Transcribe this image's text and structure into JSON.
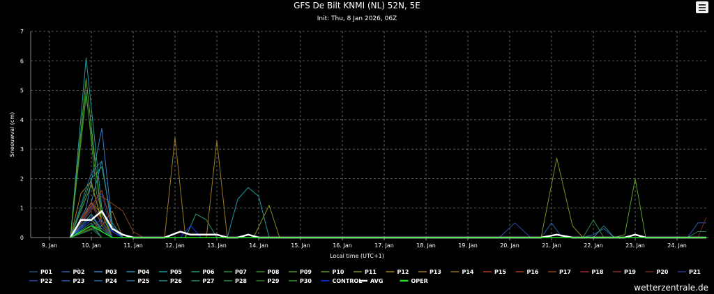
{
  "chart_data": {
    "type": "line",
    "title": "GFS De Bilt KNMI (NL) 52N, 5E",
    "subtitle": "Init: Thu, 8 Jan 2026, 06Z",
    "xlabel": "Local time (UTC+1)",
    "ylabel": "Sneeuwval (cm)",
    "ylim": [
      0,
      7
    ],
    "yticks": [
      0,
      1,
      2,
      3,
      4,
      5,
      6,
      7
    ],
    "xlim": [
      8.55,
      24.75
    ],
    "xticks": [
      {
        "x": 9,
        "label": "9. Jan"
      },
      {
        "x": 10,
        "label": "10. Jan"
      },
      {
        "x": 11,
        "label": "11. Jan"
      },
      {
        "x": 12,
        "label": "12. Jan"
      },
      {
        "x": 13,
        "label": "13. Jan"
      },
      {
        "x": 14,
        "label": "14. Jan"
      },
      {
        "x": 15,
        "label": "15. Jan"
      },
      {
        "x": 16,
        "label": "16. Jan"
      },
      {
        "x": 17,
        "label": "17. Jan"
      },
      {
        "x": 18,
        "label": "18. Jan"
      },
      {
        "x": 19,
        "label": "19. Jan"
      },
      {
        "x": 20,
        "label": "20. Jan"
      },
      {
        "x": 21,
        "label": "21. Jan"
      },
      {
        "x": 22,
        "label": "22. Jan"
      },
      {
        "x": 23,
        "label": "23. Jan"
      },
      {
        "x": 24,
        "label": "24. Jan"
      }
    ],
    "grid": true,
    "legend_position": "bottom",
    "series": [
      {
        "name": "P01",
        "color": "#1f4e8c",
        "points": [
          [
            9.5,
            0
          ],
          [
            9.75,
            0.3
          ],
          [
            10,
            0.8
          ],
          [
            10.25,
            0.3
          ],
          [
            10.5,
            0
          ],
          [
            24.7,
            0
          ]
        ]
      },
      {
        "name": "P02",
        "color": "#2266aa",
        "points": [
          [
            9.5,
            0
          ],
          [
            9.75,
            0.5
          ],
          [
            10,
            1.2
          ],
          [
            10.25,
            0.4
          ],
          [
            10.5,
            0
          ],
          [
            24.7,
            0
          ]
        ]
      },
      {
        "name": "P03",
        "color": "#3a7fc8",
        "points": [
          [
            9.5,
            0
          ],
          [
            9.875,
            1.0
          ],
          [
            10.25,
            3.7
          ],
          [
            10.5,
            0.4
          ],
          [
            10.75,
            0
          ],
          [
            24.7,
            0
          ]
        ]
      },
      {
        "name": "P04",
        "color": "#2b8fbf",
        "points": [
          [
            9.5,
            0
          ],
          [
            10,
            1.2
          ],
          [
            10.25,
            2.6
          ],
          [
            10.5,
            0.2
          ],
          [
            10.75,
            0
          ],
          [
            24.7,
            0
          ]
        ]
      },
      {
        "name": "P05",
        "color": "#1f9aa0",
        "points": [
          [
            9.5,
            0
          ],
          [
            9.875,
            6.1
          ],
          [
            10.25,
            1.0
          ],
          [
            10.5,
            0
          ],
          [
            13.25,
            0
          ],
          [
            13.5,
            1.3
          ],
          [
            13.75,
            1.7
          ],
          [
            14,
            1.4
          ],
          [
            14.25,
            0
          ],
          [
            24.7,
            0
          ]
        ]
      },
      {
        "name": "P06",
        "color": "#2a9a6e",
        "points": [
          [
            9.5,
            0
          ],
          [
            10,
            2.0
          ],
          [
            10.25,
            2.4
          ],
          [
            10.5,
            0.5
          ],
          [
            10.75,
            0
          ],
          [
            12.25,
            0
          ],
          [
            12.5,
            0.8
          ],
          [
            12.75,
            0.6
          ],
          [
            13,
            0
          ],
          [
            24.7,
            0
          ]
        ]
      },
      {
        "name": "P07",
        "color": "#2f8f3a",
        "points": [
          [
            9.5,
            0
          ],
          [
            9.875,
            5.0
          ],
          [
            10.125,
            1.5
          ],
          [
            10.5,
            0
          ],
          [
            24.7,
            0
          ]
        ]
      },
      {
        "name": "P08",
        "color": "#3b8f2a",
        "points": [
          [
            9.5,
            0
          ],
          [
            9.875,
            4.8
          ],
          [
            10.25,
            0.8
          ],
          [
            10.5,
            0
          ],
          [
            24.7,
            0
          ]
        ]
      },
      {
        "name": "P09",
        "color": "#4c9a28",
        "points": [
          [
            9.5,
            0
          ],
          [
            10,
            1.8
          ],
          [
            10.25,
            0.6
          ],
          [
            10.5,
            0
          ],
          [
            24.7,
            0
          ]
        ]
      },
      {
        "name": "P10",
        "color": "#5aa02a",
        "points": [
          [
            9.5,
            0
          ],
          [
            9.875,
            5.4
          ],
          [
            10.25,
            0.5
          ],
          [
            10.5,
            0
          ],
          [
            22.5,
            0
          ],
          [
            22.75,
            0.1
          ],
          [
            23,
            2.0
          ],
          [
            23.25,
            0
          ],
          [
            24.7,
            0
          ]
        ]
      },
      {
        "name": "P11",
        "color": "#8a8a20",
        "points": [
          [
            9.5,
            0
          ],
          [
            10,
            1.2
          ],
          [
            10.25,
            0.8
          ],
          [
            10.5,
            0
          ],
          [
            13.875,
            0
          ],
          [
            14.25,
            1.1
          ],
          [
            14.5,
            0
          ],
          [
            20.75,
            0
          ],
          [
            21.125,
            2.7
          ],
          [
            21.5,
            0.4
          ],
          [
            21.75,
            0
          ],
          [
            24.7,
            0
          ]
        ]
      },
      {
        "name": "P12",
        "color": "#9a8a20",
        "points": [
          [
            9.5,
            0
          ],
          [
            10,
            0.4
          ],
          [
            10.25,
            0.3
          ],
          [
            10.5,
            0
          ],
          [
            24.7,
            0
          ]
        ]
      },
      {
        "name": "P13",
        "color": "#a07a20",
        "points": [
          [
            9.5,
            0
          ],
          [
            9.75,
            1.5
          ],
          [
            10,
            1.9
          ],
          [
            10.25,
            0.5
          ],
          [
            10.5,
            0
          ],
          [
            11.75,
            0
          ],
          [
            12,
            3.4
          ],
          [
            12.25,
            0
          ],
          [
            12.75,
            0
          ],
          [
            13,
            3.3
          ],
          [
            13.25,
            0
          ],
          [
            24.7,
            0
          ]
        ]
      },
      {
        "name": "P14",
        "color": "#9a6a1a",
        "points": [
          [
            9.5,
            0
          ],
          [
            10.25,
            0.4
          ],
          [
            10.5,
            0.9
          ],
          [
            10.75,
            0
          ],
          [
            24.7,
            0
          ]
        ]
      },
      {
        "name": "P15",
        "color": "#b04020",
        "points": [
          [
            9.5,
            0
          ],
          [
            10,
            1.2
          ],
          [
            10.25,
            0.6
          ],
          [
            10.5,
            0
          ],
          [
            24.7,
            0
          ]
        ]
      },
      {
        "name": "P16",
        "color": "#a04020",
        "points": [
          [
            9.5,
            0
          ],
          [
            10.25,
            1.6
          ],
          [
            10.5,
            0.3
          ],
          [
            10.75,
            0
          ],
          [
            24.7,
            0
          ]
        ]
      },
      {
        "name": "P17",
        "color": "#904020",
        "points": [
          [
            9.5,
            0
          ],
          [
            10.25,
            1.4
          ],
          [
            10.75,
            0.9
          ],
          [
            11,
            0.2
          ],
          [
            11.25,
            0
          ],
          [
            24.7,
            0
          ]
        ]
      },
      {
        "name": "P18",
        "color": "#a03030",
        "points": [
          [
            9.5,
            0
          ],
          [
            10,
            0.6
          ],
          [
            10.25,
            0.3
          ],
          [
            10.5,
            0
          ],
          [
            24.7,
            0
          ]
        ]
      },
      {
        "name": "P19",
        "color": "#803020",
        "points": [
          [
            9.5,
            0
          ],
          [
            10,
            1.1
          ],
          [
            10.25,
            0.5
          ],
          [
            10.5,
            0
          ],
          [
            24.7,
            0
          ]
        ]
      },
      {
        "name": "P20",
        "color": "#702818",
        "points": [
          [
            9.5,
            0
          ],
          [
            10.25,
            0.5
          ],
          [
            10.5,
            0
          ],
          [
            24.5,
            0
          ],
          [
            24.7,
            0.7
          ]
        ]
      },
      {
        "name": "P21",
        "color": "#2a3a8a",
        "points": [
          [
            9.5,
            0
          ],
          [
            10.25,
            1.5
          ],
          [
            10.5,
            0
          ],
          [
            24.7,
            0
          ]
        ]
      },
      {
        "name": "P22",
        "color": "#2a4aa0",
        "points": [
          [
            9.5,
            0
          ],
          [
            10.25,
            0.6
          ],
          [
            10.5,
            0
          ],
          [
            19.75,
            0
          ],
          [
            20.125,
            0.5
          ],
          [
            20.5,
            0
          ],
          [
            24.7,
            0
          ]
        ]
      },
      {
        "name": "P23",
        "color": "#2a5ab0",
        "points": [
          [
            9.5,
            0
          ],
          [
            10,
            0.7
          ],
          [
            10.25,
            0.3
          ],
          [
            10.5,
            0
          ],
          [
            20.75,
            0
          ],
          [
            21,
            0.5
          ],
          [
            21.25,
            0
          ],
          [
            24.25,
            0
          ],
          [
            24.5,
            0.5
          ],
          [
            24.7,
            0.5
          ]
        ]
      },
      {
        "name": "P24",
        "color": "#2a6aa0",
        "points": [
          [
            9.5,
            0
          ],
          [
            10,
            0.4
          ],
          [
            10.25,
            0
          ],
          [
            21.75,
            0
          ],
          [
            22,
            0.1
          ],
          [
            22.25,
            0.3
          ],
          [
            22.5,
            0
          ],
          [
            24.7,
            0
          ]
        ]
      },
      {
        "name": "P25",
        "color": "#2a7a9a",
        "points": [
          [
            9.5,
            0
          ],
          [
            10,
            2.2
          ],
          [
            10.25,
            2.6
          ],
          [
            10.5,
            0.3
          ],
          [
            10.75,
            0
          ],
          [
            24.7,
            0
          ]
        ]
      },
      {
        "name": "P26",
        "color": "#2a8a8a",
        "points": [
          [
            9.5,
            0
          ],
          [
            10,
            0.8
          ],
          [
            10.25,
            0.2
          ],
          [
            10.5,
            0
          ],
          [
            22,
            0
          ],
          [
            22.25,
            0.4
          ],
          [
            22.5,
            0
          ],
          [
            24.7,
            0
          ]
        ]
      },
      {
        "name": "P27",
        "color": "#2a8a6a",
        "points": [
          [
            9.5,
            0
          ],
          [
            10,
            0.5
          ],
          [
            10.25,
            0
          ],
          [
            24.25,
            0
          ],
          [
            24.5,
            0.2
          ],
          [
            24.7,
            0.2
          ]
        ]
      },
      {
        "name": "P28",
        "color": "#2a8a4a",
        "points": [
          [
            9.5,
            0
          ],
          [
            10.25,
            0.4
          ],
          [
            10.5,
            0
          ],
          [
            21.75,
            0
          ],
          [
            22,
            0.6
          ],
          [
            22.25,
            0
          ],
          [
            24.7,
            0
          ]
        ]
      },
      {
        "name": "P29",
        "color": "#2a7a2a",
        "points": [
          [
            9.5,
            0
          ],
          [
            10,
            0.3
          ],
          [
            10.25,
            0
          ],
          [
            24.7,
            0
          ]
        ]
      },
      {
        "name": "P30",
        "color": "#2a9a2a",
        "points": [
          [
            9.5,
            0
          ],
          [
            10,
            0.6
          ],
          [
            10.25,
            0.2
          ],
          [
            10.5,
            0
          ],
          [
            24.7,
            0
          ]
        ]
      },
      {
        "name": "CONTROL",
        "color": "#1133ff",
        "points": [
          [
            9.5,
            0
          ],
          [
            10,
            0.6
          ],
          [
            10.25,
            0.9
          ],
          [
            10.5,
            0.2
          ],
          [
            10.75,
            0
          ],
          [
            12.125,
            0
          ],
          [
            12.375,
            0.4
          ],
          [
            12.625,
            0
          ],
          [
            24.7,
            0
          ]
        ]
      },
      {
        "name": "AVG",
        "color": "#ffffff",
        "width": 2.5,
        "points": [
          [
            9.5,
            0
          ],
          [
            9.75,
            0.6
          ],
          [
            10,
            0.6
          ],
          [
            10.25,
            0.9
          ],
          [
            10.5,
            0.3
          ],
          [
            10.75,
            0.1
          ],
          [
            11,
            0
          ],
          [
            11.75,
            0
          ],
          [
            12.125,
            0.2
          ],
          [
            12.375,
            0.1
          ],
          [
            13,
            0.1
          ],
          [
            13.25,
            0
          ],
          [
            13.5,
            0
          ],
          [
            13.75,
            0.1
          ],
          [
            14,
            0
          ],
          [
            20.75,
            0
          ],
          [
            21.125,
            0.1
          ],
          [
            21.5,
            0
          ],
          [
            22.75,
            0
          ],
          [
            23,
            0.1
          ],
          [
            23.25,
            0
          ],
          [
            24.7,
            0
          ]
        ]
      },
      {
        "name": "OPER",
        "color": "#22dd22",
        "width": 1.5,
        "points": [
          [
            9.5,
            0
          ],
          [
            10,
            0.4
          ],
          [
            10.25,
            0.2
          ],
          [
            10.5,
            0
          ],
          [
            24.7,
            0
          ]
        ]
      }
    ]
  },
  "credit": "wetterzentrale.de",
  "menu_icon": "hamburger-menu-icon"
}
